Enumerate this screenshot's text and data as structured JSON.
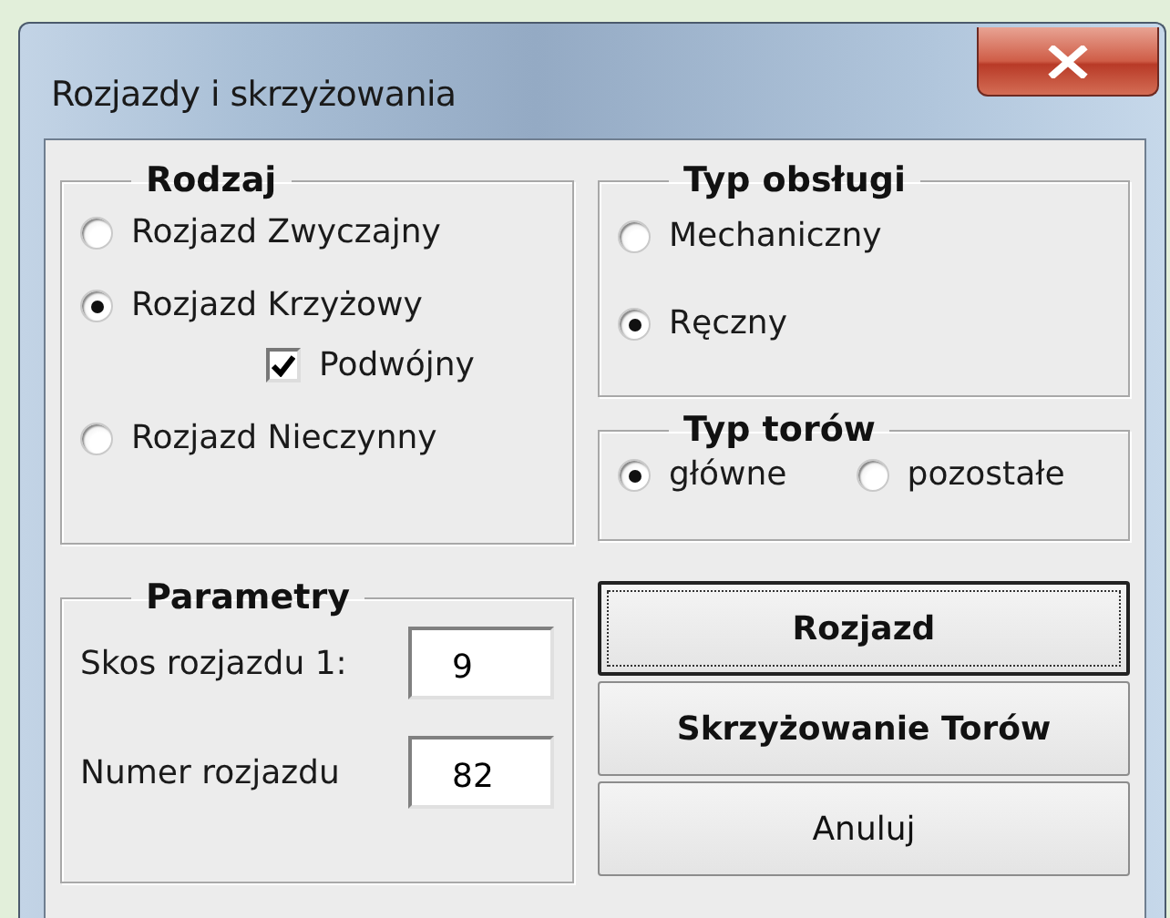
{
  "window": {
    "title": "Rozjazdy i skrzyżowania"
  },
  "rodzaj": {
    "title": "Rodzaj",
    "options": [
      {
        "kind": "radio",
        "label": "Rozjazd Zwyczajny",
        "selected": false
      },
      {
        "kind": "radio",
        "label": "Rozjazd Krzyżowy",
        "selected": true
      },
      {
        "kind": "checkbox",
        "label": "Podwójny",
        "checked": true
      },
      {
        "kind": "radio",
        "label": "Rozjazd Nieczynny",
        "selected": false
      }
    ]
  },
  "parametry": {
    "title": "Parametry",
    "fields": [
      {
        "label": "Skos rozjazdu 1:",
        "value": "9"
      },
      {
        "label": "Numer rozjazdu",
        "value": "82"
      }
    ]
  },
  "typ_obslugi": {
    "title": "Typ obsługi",
    "options": [
      {
        "label": "Mechaniczny",
        "selected": false
      },
      {
        "label": "Ręczny",
        "selected": true
      }
    ]
  },
  "typ_torow": {
    "title": "Typ torów",
    "options": [
      {
        "label": "główne",
        "selected": true
      },
      {
        "label": "pozostałe",
        "selected": false
      }
    ]
  },
  "buttons": [
    {
      "label": "Rozjazd",
      "bold": true,
      "focused": true
    },
    {
      "label": "Skrzyżowanie Torów",
      "bold": true,
      "focused": false
    },
    {
      "label": "Anuluj",
      "bold": false,
      "focused": false
    }
  ]
}
